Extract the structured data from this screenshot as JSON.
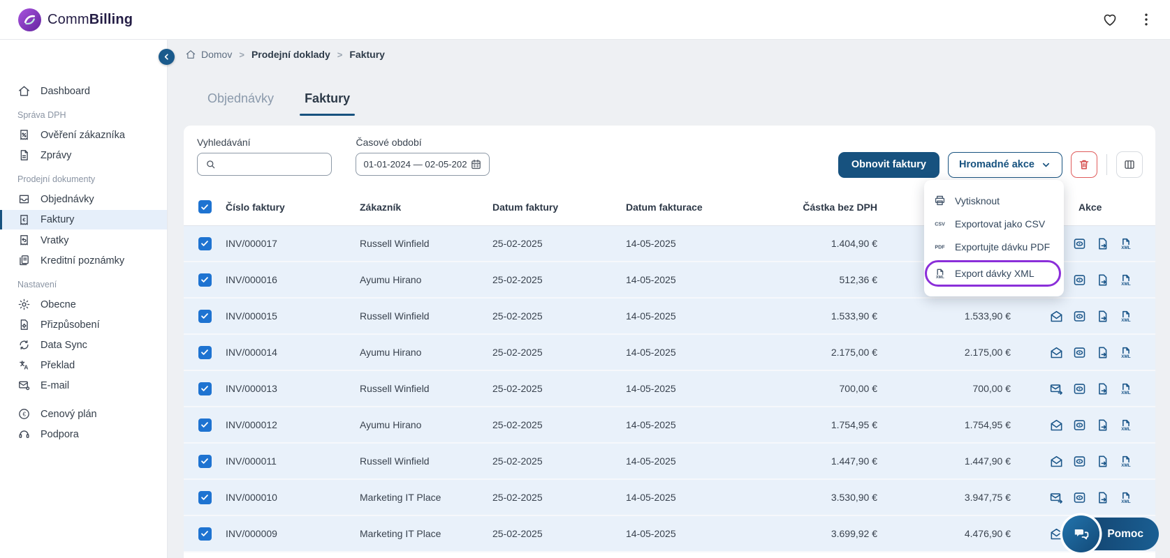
{
  "app": {
    "brand_prefix": "Comm",
    "brand_suffix": "Billing"
  },
  "topbar": {
    "icons": [
      "heart-icon",
      "kebab-menu-icon"
    ]
  },
  "sidebar": {
    "collapse_icon": "chevron-left-icon",
    "sections": [
      {
        "label": "",
        "items": [
          {
            "label": "Dashboard",
            "icon": "home-icon",
            "active": false
          }
        ]
      },
      {
        "label": "Správa DPH",
        "items": [
          {
            "label": "Ověření zákazníka",
            "icon": "receipt-percent-icon",
            "active": false
          },
          {
            "label": "Zprávy",
            "icon": "document-icon",
            "active": false
          }
        ]
      },
      {
        "label": "Prodejní dokumenty",
        "items": [
          {
            "label": "Objednávky",
            "icon": "inbox-icon",
            "active": false
          },
          {
            "label": "Faktury",
            "icon": "receipt-euro-icon",
            "active": true
          },
          {
            "label": "Vratky",
            "icon": "receipt-return-icon",
            "active": false
          },
          {
            "label": "Kreditní poznámky",
            "icon": "credit-notes-icon",
            "active": false
          }
        ]
      },
      {
        "label": "Nastavení",
        "items": [
          {
            "label": "Obecne",
            "icon": "gear-icon",
            "active": false
          },
          {
            "label": "Přizpůsobení",
            "icon": "document-gear-icon",
            "active": false
          },
          {
            "label": "Data Sync",
            "icon": "sync-icon",
            "active": false
          },
          {
            "label": "Překlad",
            "icon": "translate-icon",
            "active": false
          },
          {
            "label": "E-mail",
            "icon": "email-gear-icon",
            "active": false
          }
        ]
      },
      {
        "label": "",
        "items": [
          {
            "label": "Cenový plán",
            "icon": "euro-circle-icon",
            "active": false
          },
          {
            "label": "Podpora",
            "icon": "support-icon",
            "active": false
          }
        ]
      }
    ]
  },
  "breadcrumb": [
    {
      "label": "Domov",
      "icon": "home-icon",
      "strong": false
    },
    {
      "label": "Prodejní doklady",
      "icon": "",
      "strong": true
    },
    {
      "label": "Faktury",
      "icon": "",
      "strong": true
    }
  ],
  "tabs": [
    {
      "label": "Objednávky",
      "active": false
    },
    {
      "label": "Faktury",
      "active": true
    }
  ],
  "filters": {
    "search": {
      "label": "Vyhledávání",
      "value": "",
      "placeholder": "",
      "icon": "search-icon"
    },
    "date_range": {
      "label": "Časové období",
      "value": "01-01-2024 — 02-05-202",
      "icon": "calendar-icon"
    }
  },
  "toolbar": {
    "refresh_label": "Obnovit faktury",
    "bulk_label": "Hromadné akce",
    "bulk_chevron_icon": "chevron-down-icon",
    "delete_icon": "trash-icon",
    "columns_icon": "columns-icon"
  },
  "bulk_menu": {
    "highlight_color": "#8b2fd9",
    "items": [
      {
        "label": "Vytisknout",
        "icon": "printer-icon",
        "highlighted": false
      },
      {
        "label": "Exportovat jako CSV",
        "icon": "csv-icon",
        "highlighted": false
      },
      {
        "label": "Exportujte dávku PDF",
        "icon": "pdf-icon",
        "highlighted": false
      },
      {
        "label": "Export dávky XML",
        "icon": "xml-icon",
        "highlighted": true
      }
    ]
  },
  "table": {
    "columns": [
      "",
      "Číslo faktury",
      "Zákazník",
      "Datum faktury",
      "Datum fakturace",
      "Částka bez DPH",
      "",
      "Akce"
    ],
    "rows": [
      {
        "checked": true,
        "invoice": "INV/000017",
        "customer": "Russell Winfield",
        "invoice_date": "25-02-2025",
        "billing_date": "14-05-2025",
        "amount_excl_vat": "1.404,90 €",
        "total": "",
        "envelope": ""
      },
      {
        "checked": true,
        "invoice": "INV/000016",
        "customer": "Ayumu Hirano",
        "invoice_date": "25-02-2025",
        "billing_date": "14-05-2025",
        "amount_excl_vat": "512,36 €",
        "total": "",
        "envelope": ""
      },
      {
        "checked": true,
        "invoice": "INV/000015",
        "customer": "Russell Winfield",
        "invoice_date": "25-02-2025",
        "billing_date": "14-05-2025",
        "amount_excl_vat": "1.533,90 €",
        "total": "1.533,90 €",
        "envelope": "open"
      },
      {
        "checked": true,
        "invoice": "INV/000014",
        "customer": "Ayumu Hirano",
        "invoice_date": "25-02-2025",
        "billing_date": "14-05-2025",
        "amount_excl_vat": "2.175,00 €",
        "total": "2.175,00 €",
        "envelope": "open"
      },
      {
        "checked": true,
        "invoice": "INV/000013",
        "customer": "Russell Winfield",
        "invoice_date": "25-02-2025",
        "billing_date": "14-05-2025",
        "amount_excl_vat": "700,00 €",
        "total": "700,00 €",
        "envelope": "send"
      },
      {
        "checked": true,
        "invoice": "INV/000012",
        "customer": "Ayumu Hirano",
        "invoice_date": "25-02-2025",
        "billing_date": "14-05-2025",
        "amount_excl_vat": "1.754,95 €",
        "total": "1.754,95 €",
        "envelope": "open"
      },
      {
        "checked": true,
        "invoice": "INV/000011",
        "customer": "Russell Winfield",
        "invoice_date": "25-02-2025",
        "billing_date": "14-05-2025",
        "amount_excl_vat": "1.447,90 €",
        "total": "1.447,90 €",
        "envelope": "open"
      },
      {
        "checked": true,
        "invoice": "INV/000010",
        "customer": "Marketing IT Place",
        "invoice_date": "25-02-2025",
        "billing_date": "14-05-2025",
        "amount_excl_vat": "3.530,90 €",
        "total": "3.947,75 €",
        "envelope": "send"
      },
      {
        "checked": true,
        "invoice": "INV/000009",
        "customer": "Marketing IT Place",
        "invoice_date": "25-02-2025",
        "billing_date": "14-05-2025",
        "amount_excl_vat": "3.699,92 €",
        "total": "4.476,90 €",
        "envelope": "open"
      }
    ],
    "row_action_icons": [
      "preview-icon",
      "export-document-icon",
      "export-xml-icon"
    ]
  },
  "help_button": {
    "label": "Pomoc",
    "icon": "chat-bubbles-icon"
  },
  "colors": {
    "primary": "#17527f",
    "accent_purple": "#8b2fd9",
    "checkbox_blue": "#1e73d1",
    "danger": "#d23f3f",
    "row_bg": "#e9f1fa"
  }
}
